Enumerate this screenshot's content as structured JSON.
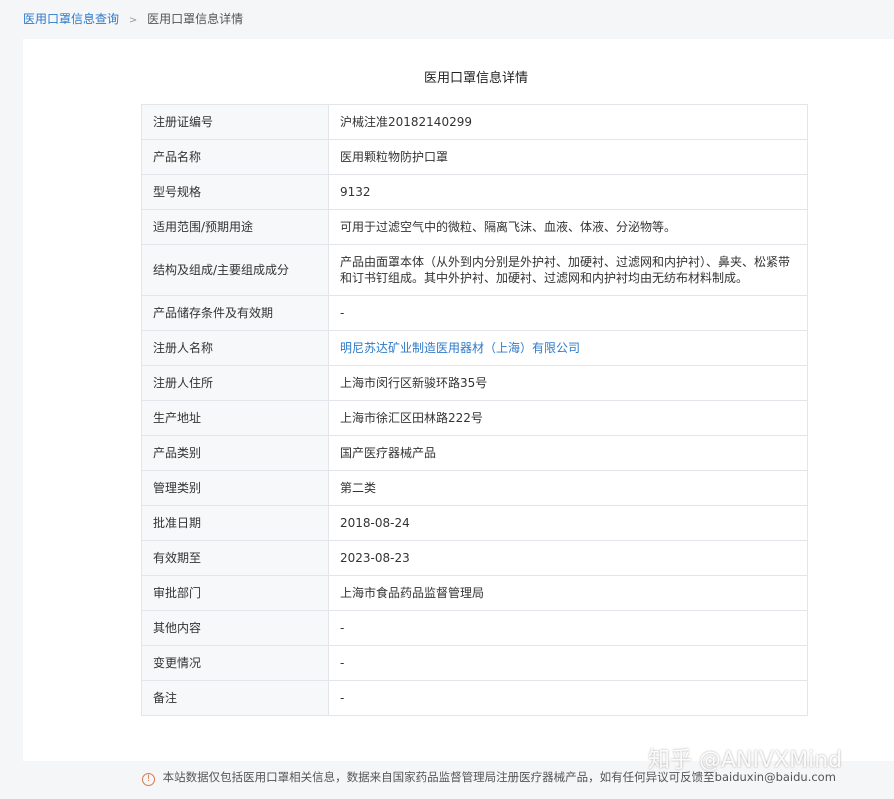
{
  "breadcrumb": {
    "link": "医用口罩信息查询",
    "separator": ">",
    "current": "医用口罩信息详情"
  },
  "title": "医用口罩信息详情",
  "rows": [
    {
      "label": "注册证编号",
      "value": "沪械注准20182140299"
    },
    {
      "label": "产品名称",
      "value": "医用颗粒物防护口罩"
    },
    {
      "label": "型号规格",
      "value": "9132"
    },
    {
      "label": "适用范围/预期用途",
      "value": "可用于过滤空气中的微粒、隔离飞沫、血液、体液、分泌物等。"
    },
    {
      "label": "结构及组成/主要组成成分",
      "value": "产品由面罩本体（从外到内分别是外护衬、加硬衬、过滤网和内护衬）、鼻夹、松紧带和订书钉组成。其中外护衬、加硬衬、过滤网和内护衬均由无纺布材料制成。"
    },
    {
      "label": "产品储存条件及有效期",
      "value": "-"
    },
    {
      "label": "注册人名称",
      "value": "明尼苏达矿业制造医用器材（上海）有限公司"
    },
    {
      "label": "注册人住所",
      "value": "上海市闵行区新骏环路35号"
    },
    {
      "label": "生产地址",
      "value": "上海市徐汇区田林路222号"
    },
    {
      "label": "产品类别",
      "value": "国产医疗器械产品"
    },
    {
      "label": "管理类别",
      "value": "第二类"
    },
    {
      "label": "批准日期",
      "value": "2018-08-24"
    },
    {
      "label": "有效期至",
      "value": "2023-08-23"
    },
    {
      "label": "审批部门",
      "value": "上海市食品药品监督管理局"
    },
    {
      "label": "其他内容",
      "value": "-"
    },
    {
      "label": "变更情况",
      "value": "-"
    },
    {
      "label": "备注",
      "value": "-"
    }
  ],
  "footer": {
    "icon": "info-icon",
    "text": "本站数据仅包括医用口罩相关信息，数据来自国家药品监督管理局注册医疗器械产品，如有任何异议可反馈至baiduxin@baidu.com"
  },
  "watermark": "知乎 @ANIVXMind",
  "colors": {
    "link": "#2d7ac8",
    "label_bg": "#f7f8fa",
    "border": "#e2e6ea",
    "page_bg": "#f5f6f8"
  }
}
